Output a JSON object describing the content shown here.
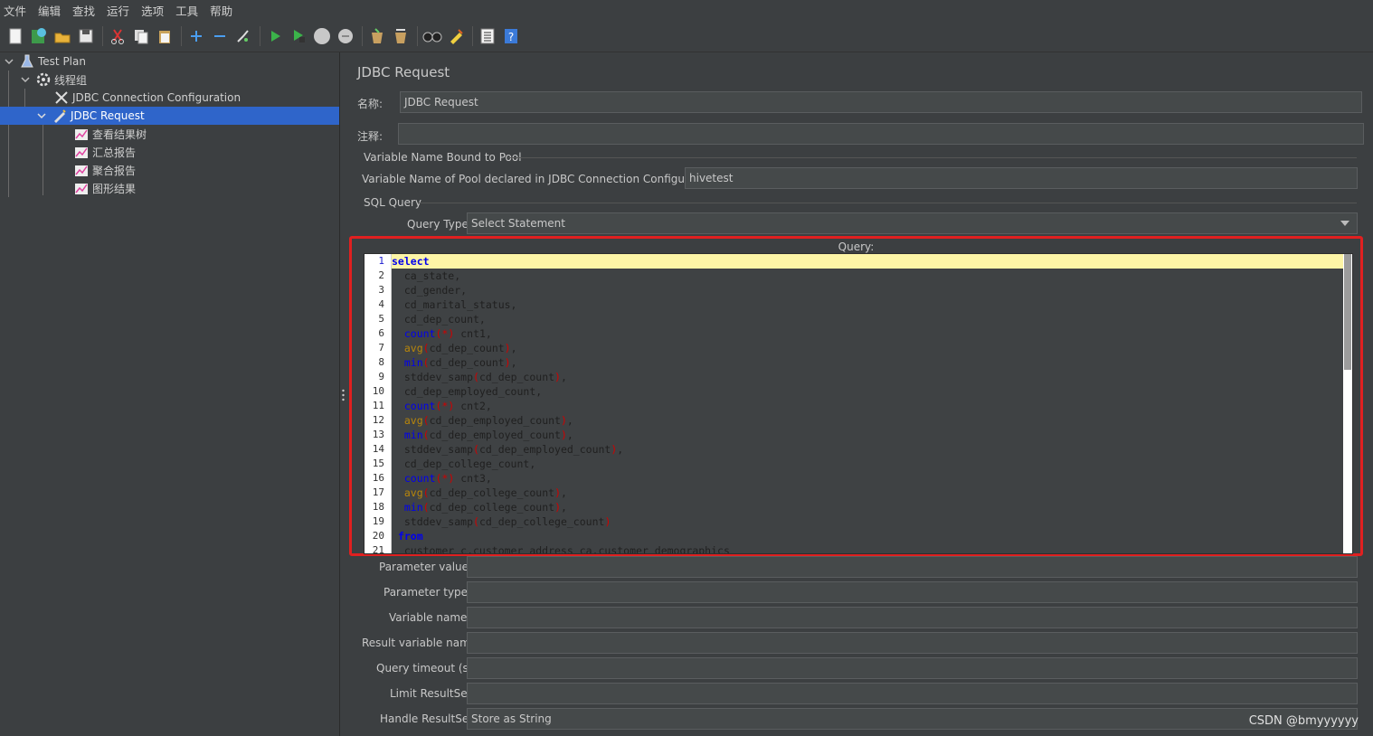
{
  "menu": [
    "文件",
    "编辑",
    "查找",
    "运行",
    "选项",
    "工具",
    "帮助"
  ],
  "toolbar": {
    "icons": [
      "new-icon",
      "templates-icon",
      "open-icon",
      "save-icon",
      "cut-icon",
      "copy-icon",
      "paste-icon",
      "expand-icon",
      "collapse-icon",
      "toggle-icon",
      "start-icon",
      "start-no-pause-icon",
      "stop-icon",
      "shutdown-icon",
      "clear-icon",
      "clear-all-icon",
      "search-icon",
      "reset-search-icon",
      "function-helper-icon",
      "help-icon"
    ]
  },
  "tree": {
    "items": [
      {
        "label": "Test Plan",
        "icon": "test-plan-icon"
      },
      {
        "label": "线程组",
        "icon": "thread-group-icon"
      },
      {
        "label": "JDBC Connection Configuration",
        "icon": "config-element-icon"
      },
      {
        "label": "JDBC Request",
        "icon": "sampler-icon"
      },
      {
        "label": "查看结果树",
        "icon": "listener-icon"
      },
      {
        "label": "汇总报告",
        "icon": "listener-icon"
      },
      {
        "label": "聚合报告",
        "icon": "listener-icon"
      },
      {
        "label": "图形结果",
        "icon": "listener-icon"
      }
    ]
  },
  "panel": {
    "title": "JDBC Request",
    "name_label": "名称:",
    "name_value": "JDBC Request",
    "comment_label": "注释:",
    "comment_value": "",
    "pool_section": "Variable Name Bound to Pool",
    "pool_label": "Variable Name of Pool declared in JDBC Connection Configuration:",
    "pool_value": "hivetest",
    "sql_section": "SQL Query",
    "query_type_label": "Query Type:",
    "query_type_value": "Select Statement",
    "query_label": "Query:",
    "query_lines": [
      "select",
      "  ca_state,",
      "  cd_gender,",
      "  cd_marital_status,",
      "  cd_dep_count,",
      "  count(*) cnt1,",
      "  avg(cd_dep_count),",
      "  min(cd_dep_count),",
      "  stddev_samp(cd_dep_count),",
      "  cd_dep_employed_count,",
      "  count(*) cnt2,",
      "  avg(cd_dep_employed_count),",
      "  min(cd_dep_employed_count),",
      "  stddev_samp(cd_dep_employed_count),",
      "  cd_dep_college_count,",
      "  count(*) cnt3,",
      "  avg(cd_dep_college_count),",
      "  min(cd_dep_college_count),",
      "  stddev_samp(cd_dep_college_count)",
      " from",
      "  customer c,customer_address ca,customer_demographics"
    ],
    "parameter_values_label": "Parameter values:",
    "parameter_values": "",
    "parameter_types_label": "Parameter types:",
    "parameter_types": "",
    "variable_names_label": "Variable names:",
    "variable_names": "",
    "result_variable_label": "Result variable name:",
    "result_variable": "",
    "query_timeout_label": "Query timeout (s):",
    "query_timeout": "",
    "limit_resultset_label": "Limit ResultSet:",
    "limit_resultset": "",
    "handle_resultset_label": "Handle ResultSet:",
    "handle_resultset_value": "Store as String"
  },
  "watermark": "CSDN @bmyyyyyy",
  "colors": {
    "background": "#3c3f41",
    "selection": "#2f65ca",
    "highlight_frame": "#e02020",
    "current_line": "#fdf5a6",
    "keyword": "#0000ee"
  }
}
